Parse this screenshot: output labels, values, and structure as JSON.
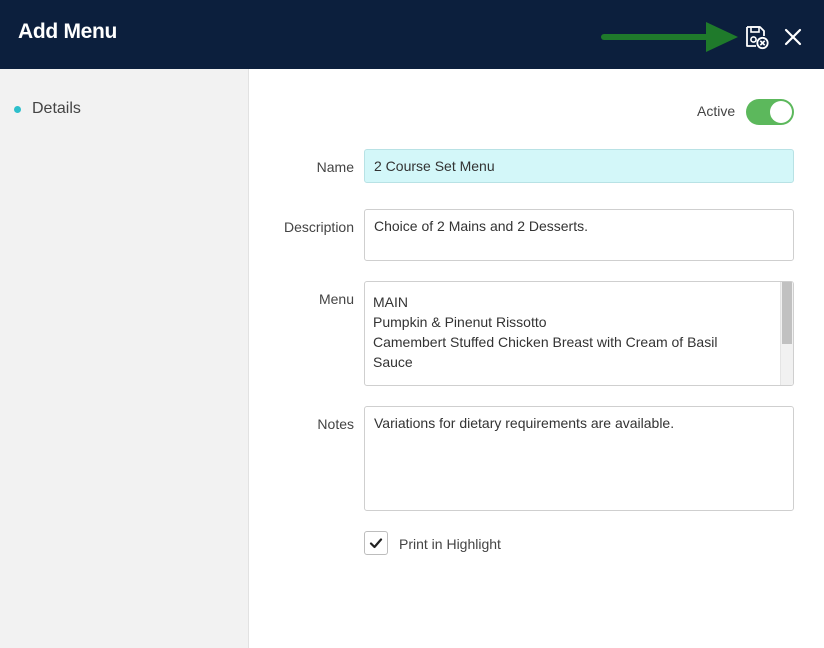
{
  "header": {
    "title": "Add Menu",
    "icons": [
      "arrow-annotation-icon",
      "save-close-icon",
      "close-icon"
    ],
    "colors": {
      "background": "#0c1f3d",
      "annotation_arrow": "#1f7a2b"
    }
  },
  "sidebar": {
    "items": [
      {
        "label": "Details",
        "icon": "bullet-dot-icon",
        "accent": "#2dbfcb"
      }
    ]
  },
  "form": {
    "active": {
      "label": "Active",
      "on": true,
      "color": "#5cb85c"
    },
    "name": {
      "label": "Name",
      "value": "2 Course Set Menu",
      "highlight": "#d3f7f9"
    },
    "description": {
      "label": "Description",
      "value": "Choice of 2 Mains and 2 Desserts."
    },
    "menu": {
      "label": "Menu",
      "lines": [
        "MAIN",
        "Pumpkin & Pinenut Rissotto",
        "Camembert Stuffed Chicken Breast with Cream of Basil",
        "Sauce"
      ]
    },
    "notes": {
      "label": "Notes",
      "value": "Variations for dietary requirements are available."
    },
    "print_in_highlight": {
      "label": "Print in Highlight",
      "checked": true
    }
  }
}
